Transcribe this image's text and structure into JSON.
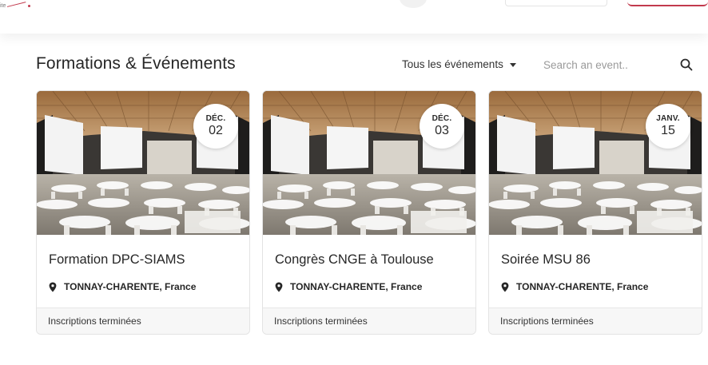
{
  "header": {
    "logo_text": "ite"
  },
  "section": {
    "title": "Formations & Événements",
    "filter_label": "Tous les événements",
    "search_placeholder": "Search an event.."
  },
  "events": [
    {
      "month": "DÉC.",
      "day": "02",
      "title": "Formation DPC-SIAMS",
      "location": "TONNAY-CHARENTE, France",
      "status": "Inscriptions terminées"
    },
    {
      "month": "DÉC.",
      "day": "03",
      "title": "Congrès CNGE à Toulouse",
      "location": "TONNAY-CHARENTE, France",
      "status": "Inscriptions terminées"
    },
    {
      "month": "JANV.",
      "day": "15",
      "title": "Soirée MSU 86",
      "location": "TONNAY-CHARENTE, France",
      "status": "Inscriptions terminées"
    }
  ],
  "colors": {
    "accent": "#c23a4d",
    "card_border": "#e3e3e3",
    "footer_bg": "#f7f7f7"
  },
  "icons": {
    "search": "search-icon",
    "location": "map-pin-icon",
    "filter_caret": "caret-down-icon"
  }
}
